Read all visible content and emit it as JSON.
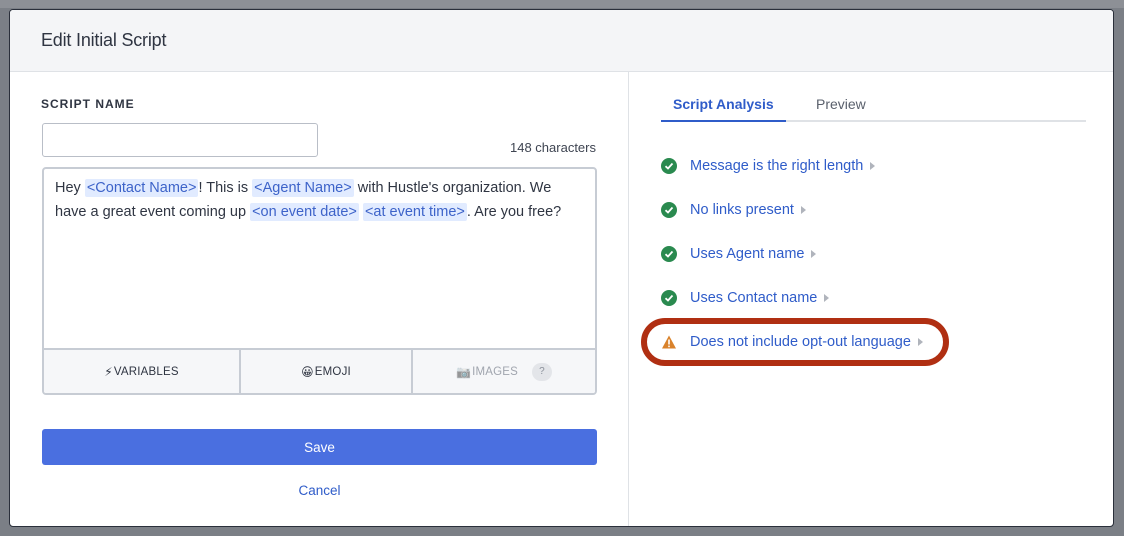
{
  "modal": {
    "title": "Edit Initial Script"
  },
  "form": {
    "script_name_label": "SCRIPT NAME",
    "script_name_value": "",
    "char_count": "148 characters",
    "message": {
      "segments": [
        {
          "text": "Hey ",
          "variable": false
        },
        {
          "text": "<Contact Name>",
          "variable": true
        },
        {
          "text": "! This is ",
          "variable": false
        },
        {
          "text": "<Agent Name>",
          "variable": true
        },
        {
          "text": " with Hustle's organization. We have a great event coming up ",
          "variable": false
        },
        {
          "text": "<on event date>",
          "variable": true
        },
        {
          "text": " ",
          "variable": false
        },
        {
          "text": "<at event time>",
          "variable": true
        },
        {
          "text": ". Are you free?",
          "variable": false
        }
      ]
    },
    "toolbar": {
      "variables": {
        "icon": "⚡",
        "label": "VARIABLES"
      },
      "emoji": {
        "icon": "😀",
        "label": "EMOJI"
      },
      "images": {
        "icon": "📷",
        "label": "IMAGES",
        "help": "?"
      }
    },
    "save_label": "Save",
    "cancel_label": "Cancel"
  },
  "analysis": {
    "tabs": [
      {
        "label": "Script Analysis",
        "active": true
      },
      {
        "label": "Preview",
        "active": false
      }
    ],
    "items": [
      {
        "label": "Message is the right length",
        "status": "pass"
      },
      {
        "label": "No links present",
        "status": "pass"
      },
      {
        "label": "Uses Agent name",
        "status": "pass"
      },
      {
        "label": "Uses Contact name",
        "status": "pass"
      },
      {
        "label": "Does not include opt-out language",
        "status": "warning",
        "highlighted": true
      }
    ]
  },
  "colors": {
    "accent": "#2f5cc9",
    "save_button": "#4a6fe0",
    "pass": "#2a8a4f",
    "warning": "#d9822b",
    "highlight_ring": "#b02f12"
  }
}
